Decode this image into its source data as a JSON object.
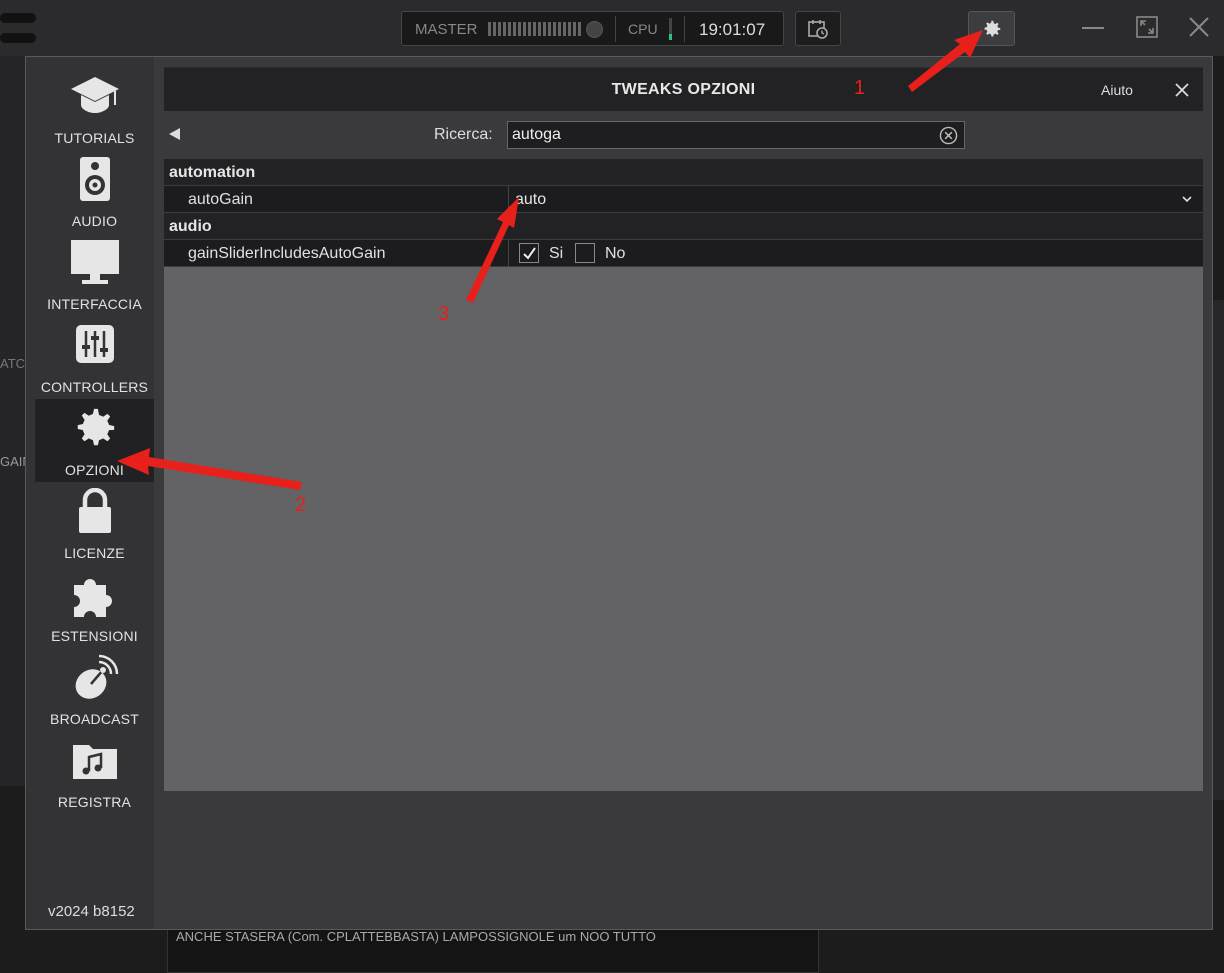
{
  "topbar": {
    "master_label": "MASTER",
    "cpu_label": "CPU",
    "clock": "19:01:07"
  },
  "background": {
    "left_text_1": "ATC",
    "left_text_2": "GAIN",
    "bottom_text": "ANCHE STASERA (Com. CPLATTEBBASTA) LAMPOSSIGNOLE um    NOO   TUTTO"
  },
  "sidebar": {
    "items": [
      {
        "label": "TUTORIALS",
        "icon": "graduation-cap-icon"
      },
      {
        "label": "AUDIO",
        "icon": "speaker-icon"
      },
      {
        "label": "INTERFACCIA",
        "icon": "monitor-icon"
      },
      {
        "label": "CONTROLLERS",
        "icon": "sliders-icon"
      },
      {
        "label": "OPZIONI",
        "icon": "gear-icon",
        "active": true
      },
      {
        "label": "LICENZE",
        "icon": "lock-icon"
      },
      {
        "label": "ESTENSIONI",
        "icon": "puzzle-icon"
      },
      {
        "label": "BROADCAST",
        "icon": "satellite-dish-icon"
      },
      {
        "label": "REGISTRA",
        "icon": "music-folder-icon"
      }
    ],
    "version": "v2024 b8152"
  },
  "panel": {
    "title": "TWEAKS OPZIONI",
    "help": "Aiuto"
  },
  "search": {
    "label": "Ricerca:",
    "value": "autoga"
  },
  "table": {
    "groups": [
      {
        "name": "automation",
        "settings": [
          {
            "name": "autoGain",
            "value": "auto",
            "type": "dropdown"
          }
        ]
      },
      {
        "name": "audio",
        "settings": [
          {
            "name": "gainSliderIncludesAutoGain",
            "type": "yesno",
            "yes_label": "Si",
            "no_label": "No",
            "yes_checked": true
          }
        ]
      }
    ]
  },
  "annotations": {
    "n1": "1",
    "n2": "2",
    "n3": "3",
    "color": "#e8201b"
  },
  "colors": {
    "background": "#1c1c1d",
    "dialog": "#3a3a3c",
    "table_empty": "#636366",
    "row": "#1c1c1e",
    "cpu_meter": "#2ec37c"
  }
}
